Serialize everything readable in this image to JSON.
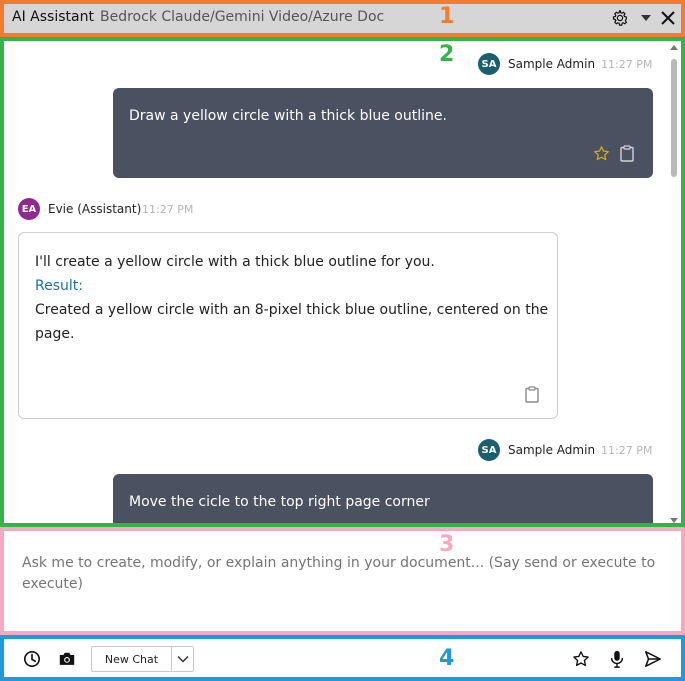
{
  "header": {
    "title": "AI Assistant",
    "subtitle": "Bedrock Claude/Gemini Video/Azure Doc",
    "icons": [
      "gear-icon",
      "caret-down-icon",
      "close-icon"
    ]
  },
  "regions": {
    "r1": "1",
    "r2": "2",
    "r3": "3",
    "r4": "4"
  },
  "chat": {
    "messages": [
      {
        "role": "user",
        "avatar": "SA",
        "sender": "Sample Admin",
        "time": "11:27 PM",
        "text": "Draw a yellow circle with a thick blue outline."
      },
      {
        "role": "assistant",
        "avatar": "EA",
        "sender": "Evie (Assistant)",
        "time": "11:27 PM",
        "intro": "I'll create a yellow circle with a thick blue outline for you.",
        "result_label": "Result:",
        "result_line1": "Created a yellow circle with an 8-pixel thick blue outline, centered on the",
        "result_line2": "page."
      },
      {
        "role": "user",
        "avatar": "SA",
        "sender": "Sample Admin",
        "time": "11:27 PM",
        "text": "Move the cicle to the top right page corner"
      }
    ],
    "colors": {
      "user_bubble": "#4a5261",
      "star": "#e0a800",
      "result_label": "#1f6fa3"
    }
  },
  "input": {
    "placeholder": "Ask me to create, modify, or explain anything in your document... (Say send or execute to execute)"
  },
  "footer": {
    "new_chat_label": "New Chat",
    "icons": [
      "history-icon",
      "camera-icon",
      "star-icon",
      "microphone-icon",
      "send-icon"
    ]
  }
}
